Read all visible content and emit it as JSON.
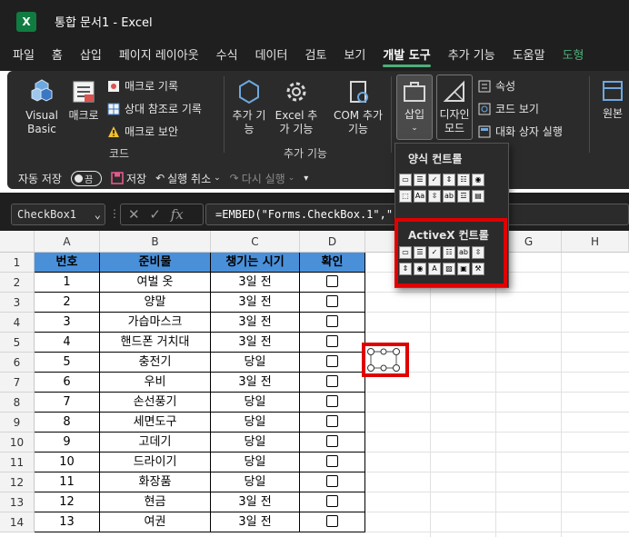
{
  "app": {
    "logo_letter": "X",
    "title": "통합 문서1  -  Excel"
  },
  "menu": [
    {
      "label": "파일"
    },
    {
      "label": "홈"
    },
    {
      "label": "삽입"
    },
    {
      "label": "페이지 레이아웃"
    },
    {
      "label": "수식"
    },
    {
      "label": "데이터"
    },
    {
      "label": "검토"
    },
    {
      "label": "보기"
    },
    {
      "label": "개발 도구"
    },
    {
      "label": "추가 기능"
    },
    {
      "label": "도움말"
    },
    {
      "label": "도형"
    }
  ],
  "ribbon": {
    "code_group": {
      "label": "코드",
      "visual_basic": "Visual Basic",
      "macro": "매크로",
      "record_macro": "매크로 기록",
      "relative_ref": "상대 참조로 기록",
      "macro_security": "매크로 보안"
    },
    "addins_group": {
      "label": "추가 기능",
      "addins": "추가 기능",
      "excel_addins": "Excel 추가 기능",
      "com_addins": "COM 추가 기능"
    },
    "controls_group": {
      "insert": "삽입",
      "design_mode": "디자인 모드",
      "properties": "속성",
      "view_code": "코드 보기",
      "run_dialog": "대화 상자 실행"
    },
    "source": "원본"
  },
  "qat": {
    "autosave": "자동 저장",
    "toggle_state": "끔",
    "save": "저장",
    "undo": "실행 취소",
    "redo": "다시 실행"
  },
  "formula_bar": {
    "name_box": "CheckBox1",
    "fx": "fx",
    "formula": "=EMBED(\"Forms.CheckBox.1\",\"\")"
  },
  "insert_dropdown": {
    "form_controls_label": "양식 컨트롤",
    "activex_label": "ActiveX 컨트롤"
  },
  "columns": [
    "A",
    "B",
    "C",
    "D",
    "E",
    "F",
    "G",
    "H"
  ],
  "table": {
    "headers": [
      "번호",
      "준비물",
      "챙기는 시기",
      "확인"
    ],
    "rows": [
      [
        "1",
        "여벌 옷",
        "3일 전"
      ],
      [
        "2",
        "양말",
        "3일 전"
      ],
      [
        "3",
        "가습마스크",
        "3일 전"
      ],
      [
        "4",
        "핸드폰 거치대",
        "3일 전"
      ],
      [
        "5",
        "충전기",
        "당일"
      ],
      [
        "6",
        "우비",
        "3일 전"
      ],
      [
        "7",
        "손선풍기",
        "당일"
      ],
      [
        "8",
        "세면도구",
        "당일"
      ],
      [
        "9",
        "고데기",
        "당일"
      ],
      [
        "10",
        "드라이기",
        "당일"
      ],
      [
        "11",
        "화장품",
        "당일"
      ],
      [
        "12",
        "현금",
        "3일 전"
      ],
      [
        "13",
        "여권",
        "3일 전"
      ]
    ]
  },
  "row_numbers": [
    "1",
    "2",
    "3",
    "4",
    "5",
    "6",
    "7",
    "8",
    "9",
    "10",
    "11",
    "12",
    "13",
    "14"
  ],
  "colors": {
    "header_fill": "#4a90d9",
    "highlight": "#e00000",
    "accent": "#107c41"
  }
}
